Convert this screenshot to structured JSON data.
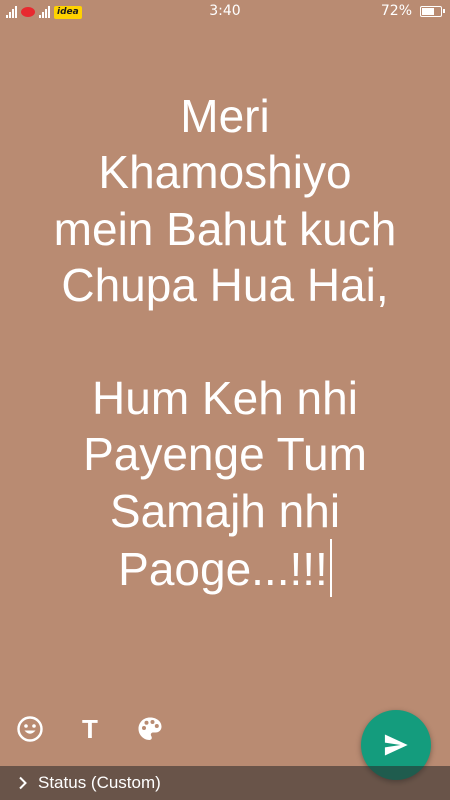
{
  "status_bar": {
    "carrier_badge": "idea",
    "time": "3:40",
    "battery_percent": "72%",
    "battery_level": 0.72,
    "icons": [
      "signal-icon",
      "jio-logo-icon",
      "signal-icon",
      "idea-badge",
      "battery-icon"
    ]
  },
  "editor": {
    "text": "Meri\nKhamoshiyo\nmein Bahut kuch\nChupa Hua Hai,\n\nHum Keh nhi\nPayenge Tum\nSamajh nhi\nPaoge...!!!",
    "text_color": "#ffffff",
    "background_color": "#b98b72"
  },
  "toolbar": {
    "emoji_icon": "emoji-icon",
    "font_label": "T",
    "color_icon": "palette-icon",
    "send_icon": "send-icon",
    "send_color": "#149c7d"
  },
  "bottom_bar": {
    "audience_label": "Status (Custom)",
    "icon": "chevron-right-icon"
  }
}
